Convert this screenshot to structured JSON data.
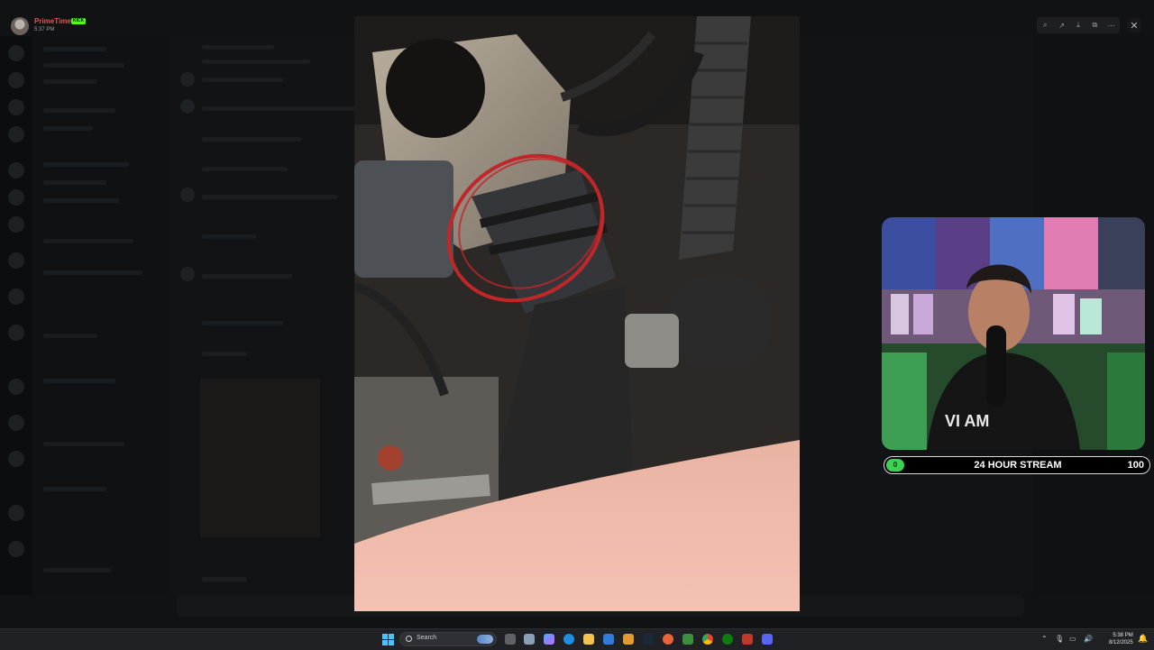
{
  "profile": {
    "name": "PrimeTime",
    "badge": "KICK",
    "time": "5:37 PM"
  },
  "viewer": {
    "toolbar_icons": [
      "zoom-icon",
      "forward-icon",
      "download-icon",
      "open-external-icon",
      "more-icon"
    ],
    "toolbar_glyphs": [
      "⌕",
      "↗",
      "⤓",
      "⧉",
      "⋯"
    ],
    "close_glyph": "✕"
  },
  "stream_bar": {
    "start": "0",
    "title": "24 HOUR STREAM",
    "end": "100",
    "progress": 0
  },
  "taskbar": {
    "search_placeholder": "Search",
    "clock_time": "5:38 PM",
    "clock_date": "8/12/2025",
    "tray_glyphs": [
      "⌃",
      "🎙",
      "▭",
      "🔊"
    ]
  },
  "colors": {
    "kick_badge": "#53fc18",
    "progress_fill": "#39d353",
    "windows_blue": "#4cc2ff",
    "red_annotation": "#c0262a"
  }
}
